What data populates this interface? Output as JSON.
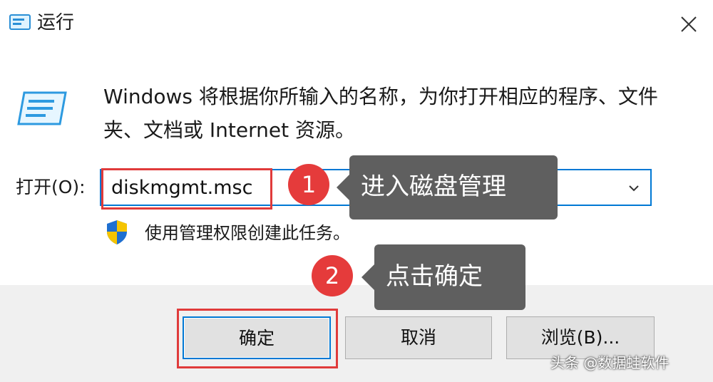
{
  "window": {
    "title": "运行",
    "icons": {
      "app": "run-app-icon",
      "close": "close-icon"
    }
  },
  "content": {
    "description": "Windows 将根据你所输入的名称，为你打开相应的程序、文件夹、文档或 Internet 资源。",
    "open_label": "打开(O):",
    "input_value": "diskmgmt.msc",
    "admin_note": "使用管理权限创建此任务。"
  },
  "annotations": {
    "step1_number": "1",
    "step1_text": "进入磁盘管理",
    "step2_number": "2",
    "step2_text": "点击确定",
    "highlight_color": "#e03b3b",
    "bubble_color": "#5f5f5f"
  },
  "buttons": {
    "ok": "确定",
    "cancel": "取消",
    "browse": "浏览(B)..."
  },
  "watermark": "头条 @数据蛙软件",
  "colors": {
    "accent": "#0078d4",
    "footer_bg": "#f0f0f0"
  }
}
